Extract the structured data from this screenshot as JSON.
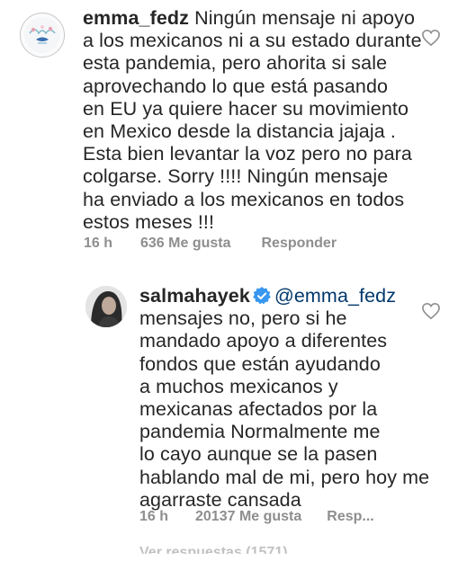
{
  "comments": [
    {
      "username": "emma_fedz",
      "text": " Ningún mensaje ni apoyo\na los mexicanos ni a su estado durante\nesta pandemia, pero ahorita si sale\naprovechando lo que está pasando\nen EU ya quiere hacer su movimiento\nen Mexico desde la distancia jajaja .\nEsta bien levantar la voz pero no para\ncolgarse. Sorry !!!! Ningún mensaje\nha enviado a los mexicanos en todos\nestos meses !!!",
      "time": "16 h",
      "likes": "636 Me gusta",
      "reply_label": "Responder",
      "avatar_icon": "flower-logo-icon"
    },
    {
      "username": "salmahayek",
      "verified": true,
      "mention": "@emma_fedz",
      "text": "\nmensajes no, pero si he\nmandado apoyo a diferentes\nfondos que están ayudando\na muchos mexicanos y\nmexicanas afectados por la\npandemia  Normalmente me\nlo cayo aunque se la pasen\nhablando mal de mi, pero hoy me\nagarraste cansada",
      "time": "16 h",
      "likes": "20137 Me gusta",
      "reply_label": "Resp...",
      "avatar_icon": "profile-photo-icon"
    }
  ],
  "view_replies": "Ver respuestas (1571)",
  "colors": {
    "text": "#262626",
    "meta": "#8e8e8e",
    "mention": "#00376b",
    "verified": "#3897f0"
  }
}
